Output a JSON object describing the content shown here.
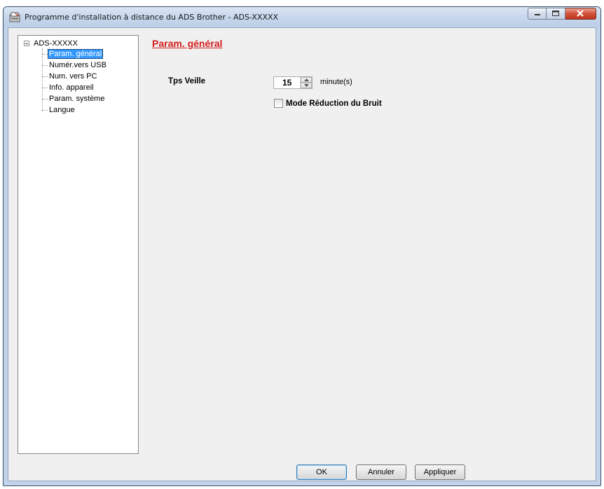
{
  "window": {
    "title": "Programme d'installation à distance du ADS Brother - ADS-XXXXX"
  },
  "tree": {
    "root_label": "ADS-XXXXX",
    "items": [
      {
        "label": "Param. général",
        "selected": true
      },
      {
        "label": "Numér.vers USB",
        "selected": false
      },
      {
        "label": "Num. vers PC",
        "selected": false
      },
      {
        "label": "Info. appareil",
        "selected": false
      },
      {
        "label": "Param. système",
        "selected": false
      },
      {
        "label": "Langue",
        "selected": false
      }
    ]
  },
  "panel": {
    "title": "Param. général",
    "title_color": "#d41b1b",
    "sleep_label": "Tps Veille",
    "sleep_value": "15",
    "sleep_unit": "minute(s)",
    "noise_label": "Mode Réduction du Bruit",
    "noise_checked": false
  },
  "buttons": {
    "ok": "OK",
    "cancel": "Annuler",
    "apply": "Appliquer"
  }
}
